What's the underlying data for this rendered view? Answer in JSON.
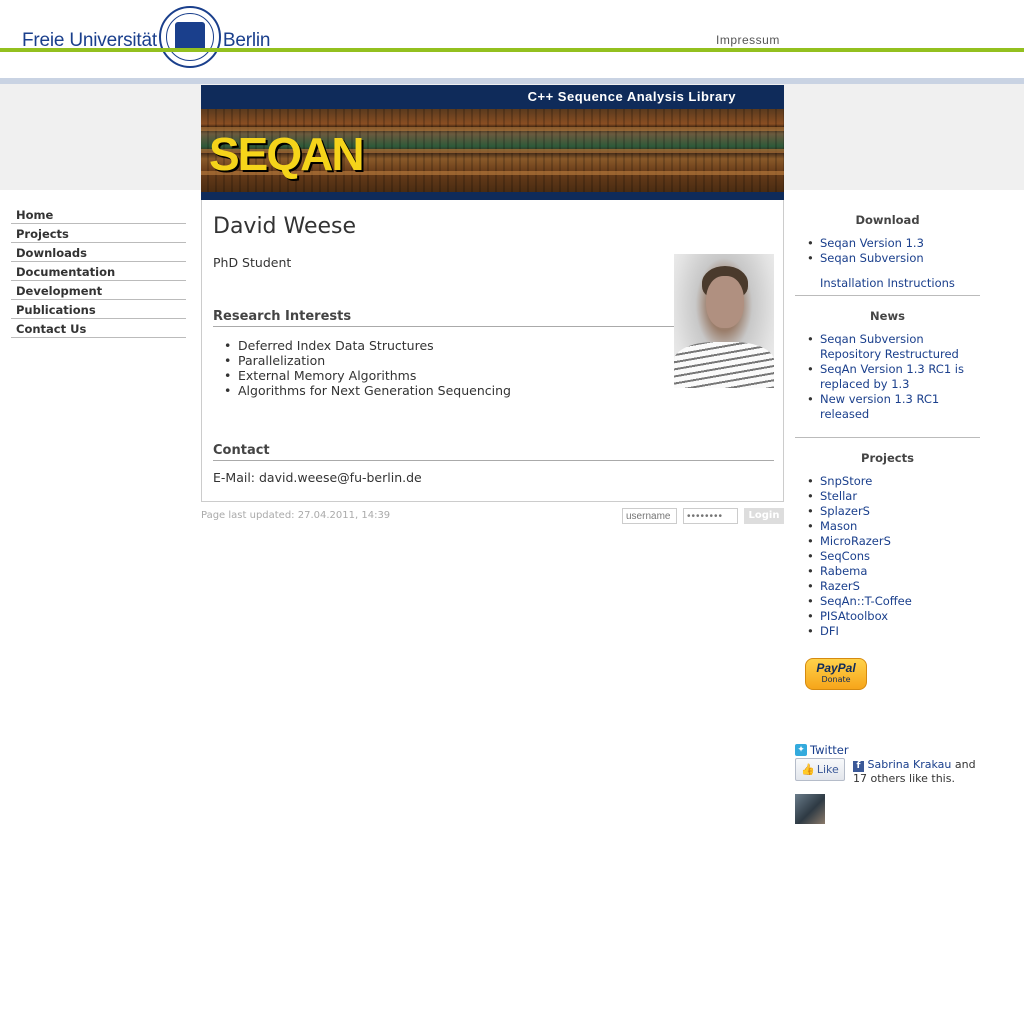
{
  "header": {
    "org_left": "Freie Universität",
    "org_right": "Berlin",
    "impressum": "Impressum"
  },
  "banner": {
    "title": "C++ Sequence Analysis Library",
    "logo_text": "SEQAN"
  },
  "nav": {
    "items": [
      "Home",
      "Projects",
      "Downloads",
      "Documentation",
      "Development",
      "Publications",
      "Contact Us"
    ]
  },
  "main": {
    "title": "David Weese",
    "role": "PhD Student",
    "research_heading": "Research Interests",
    "research_items": [
      "Deferred Index Data Structures",
      "Parallelization",
      "External Memory Algorithms",
      "Algorithms for Next Generation Sequencing"
    ],
    "contact_heading": "Contact",
    "contact_email": "E-Mail: david.weese@fu-berlin.de"
  },
  "footer": {
    "updated": "Page last updated: 27.04.2011, 14:39",
    "username_placeholder": "username",
    "password_placeholder": "••••••••",
    "login_label": "Login"
  },
  "sidebar": {
    "download_heading": "Download",
    "download_items": [
      "Seqan Version 1.3",
      "Seqan Subversion"
    ],
    "install_link": "Installation Instructions",
    "news_heading": "News",
    "news_items": [
      "Seqan Subversion Repository Restructured",
      "SeqAn Version 1.3 RC1 is replaced by 1.3",
      "New version 1.3 RC1 released"
    ],
    "projects_heading": "Projects",
    "project_items": [
      "SnpStore",
      "Stellar",
      "SplazerS",
      "Mason",
      "MicroRazerS",
      "SeqCons",
      "Rabema",
      "RazerS",
      "SeqAn::T-Coffee",
      "PISAtoolbox",
      "DFI"
    ],
    "paypal_word": "PayPal",
    "paypal_donate": "Donate",
    "twitter_label": "Twitter",
    "like_label": "Like",
    "fb_name": "Sabrina Krakau",
    "fb_rest": " and 17 others like this."
  },
  "colors": {
    "accent_green": "#93c01f",
    "link_blue": "#1a3f8c",
    "banner_navy": "#0f2b5a"
  }
}
